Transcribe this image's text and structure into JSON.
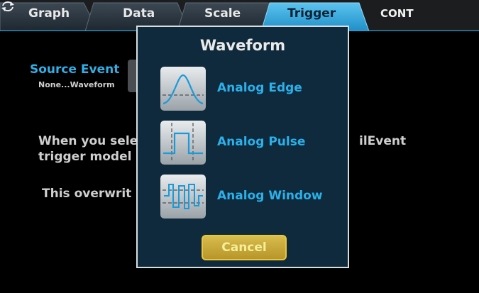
{
  "tabs": [
    {
      "label": "Graph",
      "active": false
    },
    {
      "label": "Data",
      "active": false
    },
    {
      "label": "Scale",
      "active": false
    },
    {
      "label": "Trigger",
      "active": true
    }
  ],
  "status": {
    "cont_label": "CONT",
    "cont_icon": "refresh-arrows-icon"
  },
  "background": {
    "source_event_title": "Source Event",
    "source_event_value": "None...Waveform",
    "description_line1": "When you sele",
    "description_right": "ilEvent",
    "description_line2": "trigger model",
    "description_line3": "This overwrit"
  },
  "dialog": {
    "title": "Waveform",
    "options": [
      {
        "label": "Analog Edge",
        "icon": "analog-edge-icon"
      },
      {
        "label": "Analog Pulse",
        "icon": "analog-pulse-icon"
      },
      {
        "label": "Analog Window",
        "icon": "analog-window-icon"
      }
    ],
    "cancel_label": "Cancel"
  },
  "colors": {
    "accent_blue": "#2bb0ea",
    "dialog_bg": "#0e2a3c",
    "cancel_yellow": "#d8bc4c",
    "active_tab": "#2a9fd6"
  }
}
